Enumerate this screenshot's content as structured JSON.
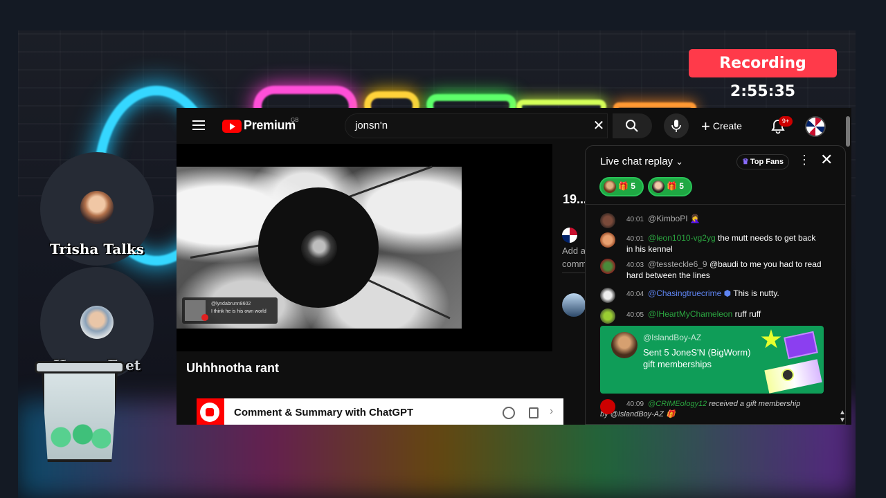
{
  "overlay": {
    "recording_label": "Recording 2:55:35"
  },
  "participants": [
    {
      "name": "Trisha Talks"
    },
    {
      "name": "Happy Feet"
    }
  ],
  "youtube": {
    "brand": "Premium",
    "region_code": "GB",
    "search_query": "jonsn'n",
    "create_label": "Create",
    "notification_count": "9+",
    "video_title": "Uhhhnotha rant",
    "mini_comment_user": "@lyndabrunn8602",
    "mini_comment_text": "I think he is his own world",
    "views_peek": "19...",
    "peek_text_1": "Add a",
    "peek_text_2": "comm",
    "chatgpt_bar_label": "Comment & Summary with ChatGPT"
  },
  "chat": {
    "title": "Live chat replay",
    "top_fans_label": "Top Fans",
    "gifters": [
      {
        "count": "5"
      },
      {
        "count": "5"
      }
    ],
    "messages": [
      {
        "time": "40:01",
        "author": "@KimboPI",
        "text": "🤦‍♀️",
        "author_color": "gray"
      },
      {
        "time": "40:01",
        "author": "@leon1010-vg2yg",
        "text": "the mutt needs to get back in his kennel",
        "author_color": "green"
      },
      {
        "time": "40:03",
        "author": "@tessteckle6_9",
        "text": "@baudi to me you had to read hard between the lines",
        "author_color": "gray"
      },
      {
        "time": "40:04",
        "author": "@Chasingtruecrime",
        "text": "This is nutty.",
        "author_color": "blue"
      },
      {
        "time": "40:05",
        "author": "@IHeartMyChameleon",
        "text": "ruff ruff",
        "author_color": "green"
      }
    ],
    "gift": {
      "user": "@IslandBoy-AZ",
      "sent_text": "Sent 5 JoneS'N (BigWorm)",
      "type_text": "gift memberships"
    },
    "last": {
      "time": "40:09",
      "author": "@CRIMEology12",
      "text": "received a gift membership",
      "by_text": "by @IslandBoy-AZ"
    }
  }
}
